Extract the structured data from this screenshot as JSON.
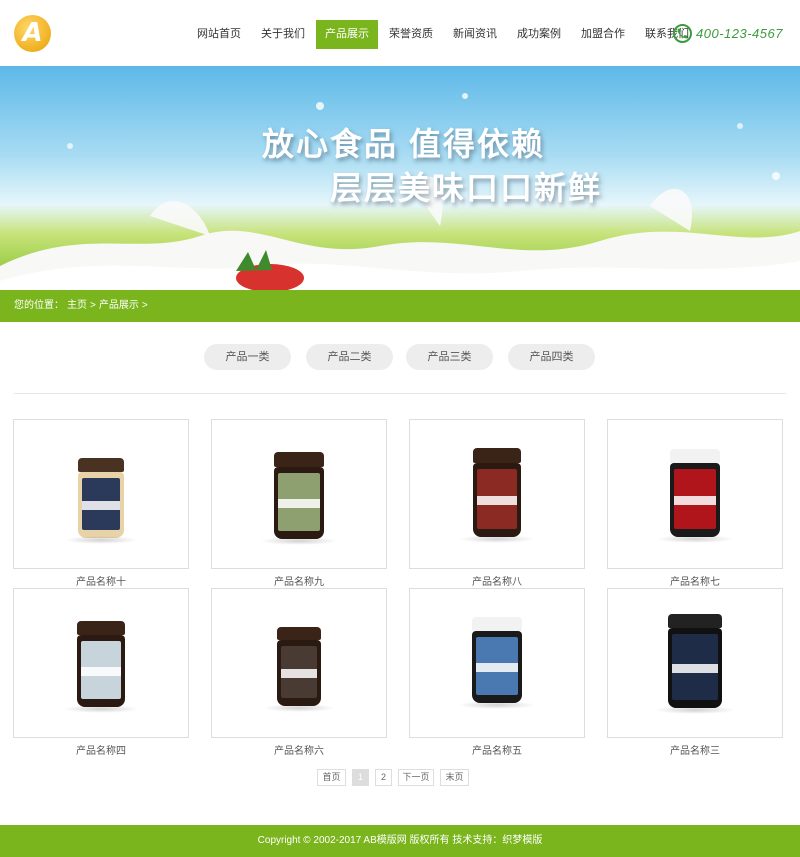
{
  "header": {
    "logo_letter": "A",
    "nav": [
      {
        "label": "网站首页",
        "active": false
      },
      {
        "label": "关于我们",
        "active": false
      },
      {
        "label": "产品展示",
        "active": true
      },
      {
        "label": "荣誉资质",
        "active": false
      },
      {
        "label": "新闻资讯",
        "active": false
      },
      {
        "label": "成功案例",
        "active": false
      },
      {
        "label": "加盟合作",
        "active": false
      },
      {
        "label": "联系我们",
        "active": false
      }
    ],
    "phone": "400-123-4567"
  },
  "banner": {
    "line1": "放心食品 值得依赖",
    "line2": "层层美味口口新鲜"
  },
  "breadcrumb": {
    "prefix": "您的位置：",
    "home": "主页",
    "sep1": ">",
    "current": "产品展示",
    "sep2": ">"
  },
  "categories": [
    "产品一类",
    "产品二类",
    "产品三类",
    "产品四类"
  ],
  "products": [
    {
      "name": "产品名称十",
      "lid": "#4a3222",
      "jar": "#e8d3a8",
      "label": "#2b3a5a",
      "label_text": "BLUE BORAGE"
    },
    {
      "name": "产品名称九",
      "lid": "#3a2418",
      "jar": "#2a1a12",
      "label": "#8fa070",
      "label_text": "KAMAHI"
    },
    {
      "name": "产品名称八",
      "lid": "#3a2418",
      "jar": "#2a1a12",
      "label": "#8a2a22",
      "label_text": "REWAREWA"
    },
    {
      "name": "产品名称七",
      "lid": "#f2f2f2",
      "jar": "#1a1a1a",
      "label": "#b0151c",
      "label_text": ""
    },
    {
      "name": "产品名称四",
      "lid": "#3a2418",
      "jar": "#2a1a12",
      "label": "#c8d4dc",
      "label_text": "MANUKA BLEND"
    },
    {
      "name": "产品名称六",
      "lid": "#3a2418",
      "jar": "#2a1a12",
      "label": "#4a3a34",
      "label_text": "MANUKA"
    },
    {
      "name": "产品名称五",
      "lid": "#f2f2f2",
      "jar": "#1a1a1a",
      "label": "#4a78b0",
      "label_text": ""
    },
    {
      "name": "产品名称三",
      "lid": "#222222",
      "jar": "#111111",
      "label": "#1e2c48",
      "label_text": "MANUKA"
    }
  ],
  "pagination": {
    "first": "首页",
    "pages": [
      "1",
      "2"
    ],
    "current": "1",
    "next": "下一页",
    "last": "末页"
  },
  "footer": {
    "text": "Copyright © 2002-2017 AB模版网 版权所有  技术支持：织梦模版"
  },
  "colors": {
    "accent": "#7ab51d",
    "phone": "#3c9b3c"
  }
}
